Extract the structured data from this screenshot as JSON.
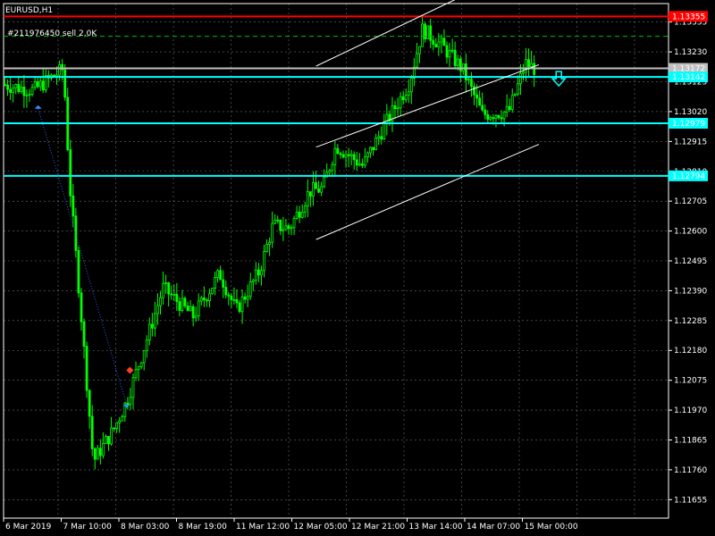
{
  "window": {
    "title": "EURUSD,H1"
  },
  "order_label": "#211976450 sell 2.0K",
  "colors": {
    "background": "#000000",
    "grid": "#c8c8c8",
    "bull": "#00ff00",
    "bear": "#00ff00",
    "resistance": "#ff0000",
    "level": "#00ffff",
    "bid": "#c0c0c0",
    "channel": "#ffffff",
    "tp_dash": "#00c000",
    "arrow": "#00ffff"
  },
  "chart_data": {
    "type": "candlestick",
    "symbol": "EURUSD",
    "timeframe": "H1",
    "ylim": [
      1.1159,
      1.134
    ],
    "y_ticks": [
      "1.13335",
      "1.13230",
      "1.13125",
      "1.13020",
      "1.12915",
      "1.12810",
      "1.12705",
      "1.12600",
      "1.12495",
      "1.12390",
      "1.12285",
      "1.12180",
      "1.12075",
      "1.11970",
      "1.11865",
      "1.11760",
      "1.11655"
    ],
    "x_ticks": [
      "6 Mar 2019",
      "7 Mar 10:00",
      "8 Mar 03:00",
      "8 Mar 19:00",
      "11 Mar 12:00",
      "12 Mar 05:00",
      "12 Mar 21:00",
      "13 Mar 14:00",
      "14 Mar 07:00",
      "15 Mar 00:00"
    ],
    "horizontal_lines": [
      {
        "name": "resistance",
        "price": 1.13355,
        "label": "1.13355",
        "color": "#ff0000",
        "style": "solid"
      },
      {
        "name": "take-profit",
        "price": 1.13285,
        "label": "",
        "color": "#00c000",
        "style": "dashed"
      },
      {
        "name": "bid",
        "price": 1.13172,
        "label": "1.13172",
        "color": "#c0c0c0",
        "style": "solid"
      },
      {
        "name": "ask",
        "price": 1.13142,
        "label": "1.13142",
        "color": "#00ffff",
        "style": "solid"
      },
      {
        "name": "level-2",
        "price": 1.12979,
        "label": "1.12979",
        "color": "#00ffff",
        "style": "solid"
      },
      {
        "name": "level-3",
        "price": 1.12794,
        "label": "1.12794",
        "color": "#00ffff",
        "style": "solid"
      }
    ],
    "channel": {
      "x_start_pct": 0.47,
      "x_end_pct": 0.805,
      "upper": [
        1.1318,
        1.13555
      ],
      "middle": [
        1.12895,
        1.13185
      ],
      "lower": [
        1.1257,
        1.12905
      ]
    },
    "anchors": [
      {
        "x_pct": 0,
        "price": 1.13115
      },
      {
        "x_pct": 0.045,
        "price": 1.13095
      },
      {
        "x_pct": 0.09,
        "price": 1.1317
      },
      {
        "x_pct": 0.1,
        "price": 1.1275
      },
      {
        "x_pct": 0.115,
        "price": 1.1235
      },
      {
        "x_pct": 0.135,
        "price": 1.1179
      },
      {
        "x_pct": 0.165,
        "price": 1.119
      },
      {
        "x_pct": 0.185,
        "price": 1.12
      },
      {
        "x_pct": 0.21,
        "price": 1.1218
      },
      {
        "x_pct": 0.24,
        "price": 1.124
      },
      {
        "x_pct": 0.285,
        "price": 1.123
      },
      {
        "x_pct": 0.325,
        "price": 1.1245
      },
      {
        "x_pct": 0.35,
        "price": 1.1232
      },
      {
        "x_pct": 0.385,
        "price": 1.1246
      },
      {
        "x_pct": 0.405,
        "price": 1.1262
      },
      {
        "x_pct": 0.43,
        "price": 1.1261
      },
      {
        "x_pct": 0.46,
        "price": 1.1274
      },
      {
        "x_pct": 0.48,
        "price": 1.1275
      },
      {
        "x_pct": 0.5,
        "price": 1.129
      },
      {
        "x_pct": 0.54,
        "price": 1.1283
      },
      {
        "x_pct": 0.58,
        "price": 1.13
      },
      {
        "x_pct": 0.61,
        "price": 1.1312
      },
      {
        "x_pct": 0.63,
        "price": 1.1331
      },
      {
        "x_pct": 0.66,
        "price": 1.1325
      },
      {
        "x_pct": 0.69,
        "price": 1.1317
      },
      {
        "x_pct": 0.72,
        "price": 1.1301
      },
      {
        "x_pct": 0.76,
        "price": 1.1302
      },
      {
        "x_pct": 0.785,
        "price": 1.1319
      },
      {
        "x_pct": 0.8,
        "price": 1.1317
      }
    ],
    "trade": {
      "entry": {
        "x_pct": 0.052,
        "price": 1.1303
      },
      "exit": {
        "x_pct": 0.185,
        "price": 1.1199
      },
      "marker": {
        "x_pct": 0.19,
        "price": 1.1211
      }
    },
    "sell_arrow_x_pct": 0.835
  }
}
